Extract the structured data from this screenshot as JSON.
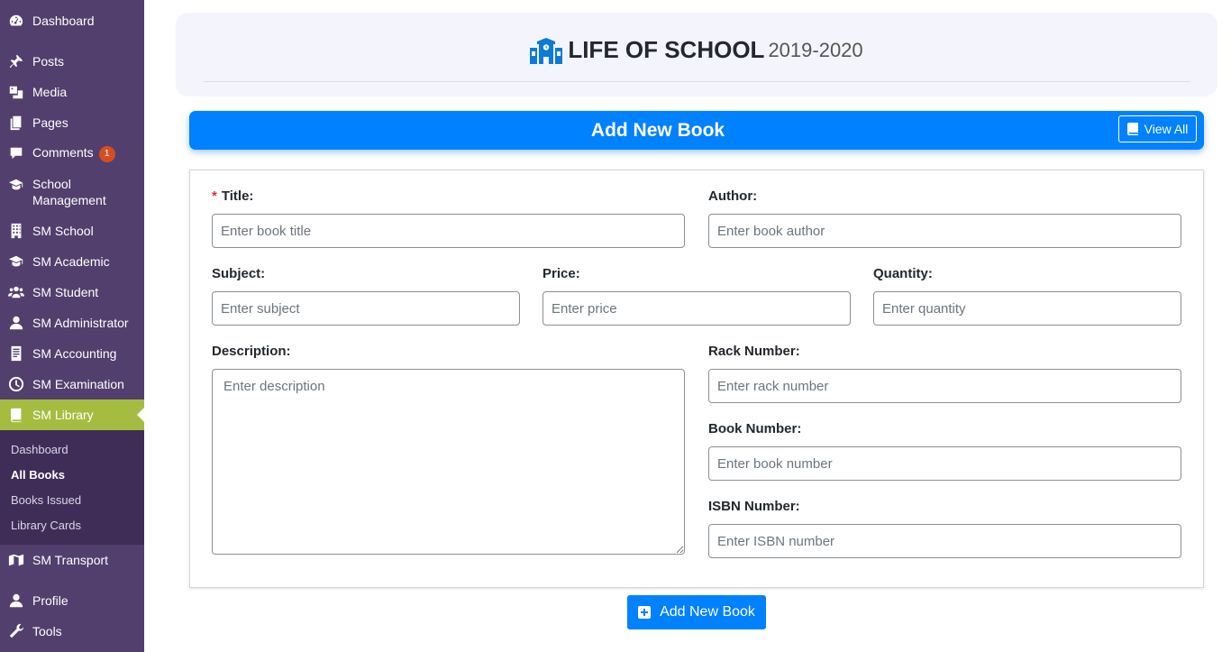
{
  "sidebar": {
    "items": [
      {
        "label": "Dashboard",
        "icon": "dashboard-icon"
      },
      {
        "label": "Posts",
        "icon": "pin-icon"
      },
      {
        "label": "Media",
        "icon": "media-icon"
      },
      {
        "label": "Pages",
        "icon": "pages-icon"
      },
      {
        "label": "Comments",
        "icon": "comment-icon",
        "badge": "1"
      },
      {
        "label": "School\nManagement",
        "icon": "graduation-cap-icon"
      },
      {
        "label": "SM School",
        "icon": "building-icon"
      },
      {
        "label": "SM Academic",
        "icon": "graduation-cap-icon"
      },
      {
        "label": "SM Student",
        "icon": "users-icon"
      },
      {
        "label": "SM Administrator",
        "icon": "user-icon"
      },
      {
        "label": "SM Accounting",
        "icon": "invoice-icon"
      },
      {
        "label": "SM Examination",
        "icon": "clock-icon"
      },
      {
        "label": "SM Library",
        "icon": "book-icon"
      },
      {
        "label": "SM Transport",
        "icon": "map-icon"
      },
      {
        "label": "Profile",
        "icon": "user-icon"
      },
      {
        "label": "Tools",
        "icon": "wrench-icon"
      }
    ],
    "submenu": [
      {
        "label": "Dashboard"
      },
      {
        "label": "All Books",
        "current": true
      },
      {
        "label": "Books Issued"
      },
      {
        "label": "Library Cards"
      }
    ],
    "colors": {
      "background": "#523f6d",
      "active": "#a4bd40",
      "submenu": "#3f2d57"
    }
  },
  "header": {
    "school_name": "LIFE OF SCHOOL",
    "session": "2019-2020",
    "icon": "school-icon"
  },
  "title_bar": {
    "title": "Add New Book",
    "view_all_label": "View All",
    "accent": "#0081ff"
  },
  "form": {
    "title": {
      "label": "Title:",
      "required_mark": "*",
      "placeholder": "Enter book title",
      "value": ""
    },
    "author": {
      "label": "Author:",
      "placeholder": "Enter book author",
      "value": ""
    },
    "subject": {
      "label": "Subject:",
      "placeholder": "Enter subject",
      "value": ""
    },
    "price": {
      "label": "Price:",
      "placeholder": "Enter price",
      "value": ""
    },
    "quantity": {
      "label": "Quantity:",
      "placeholder": "Enter quantity",
      "value": ""
    },
    "description": {
      "label": "Description:",
      "placeholder": "Enter description",
      "value": ""
    },
    "rack_number": {
      "label": "Rack Number:",
      "placeholder": "Enter rack number",
      "value": ""
    },
    "book_number": {
      "label": "Book Number:",
      "placeholder": "Enter book number",
      "value": ""
    },
    "isbn_number": {
      "label": "ISBN Number:",
      "placeholder": "Enter ISBN number",
      "value": ""
    }
  },
  "submit": {
    "label": "Add New Book",
    "icon": "plus-square-icon"
  }
}
